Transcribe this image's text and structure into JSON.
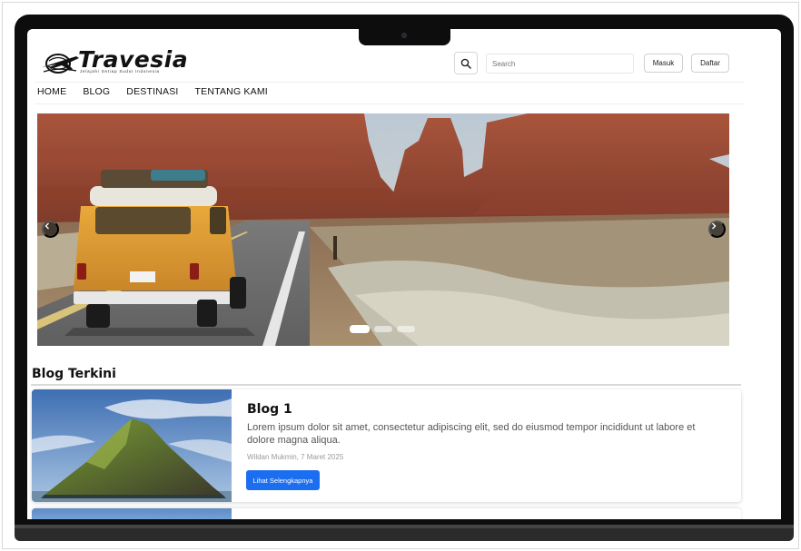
{
  "brand": {
    "name": "Travesia",
    "tagline": "Jelajahi Setiap Sudut Indonesia"
  },
  "header": {
    "search_placeholder": "Search",
    "login_label": "Masuk",
    "register_label": "Daftar"
  },
  "nav": {
    "items": [
      {
        "label": "HOME"
      },
      {
        "label": "BLOG"
      },
      {
        "label": "DESTINASI"
      },
      {
        "label": "TENTANG KAMI"
      }
    ]
  },
  "hero": {
    "slide_count": 3,
    "active_slide": 1,
    "prev_icon": "chevron-left-icon",
    "next_icon": "chevron-right-icon"
  },
  "blog_section": {
    "title": "Blog Terkini",
    "posts": [
      {
        "title": "Blog 1",
        "excerpt": "Lorem ipsum dolor sit amet, consectetur adipiscing elit, sed do eiusmod tempor incididunt ut labore et dolore magna aliqua.",
        "meta": "Wildan Mukmin, 7 Maret 2025",
        "cta": "Lihat Selengkapnya"
      }
    ]
  },
  "colors": {
    "primary_button": "#1b6ef0",
    "bezel": "#0d0d0d"
  }
}
